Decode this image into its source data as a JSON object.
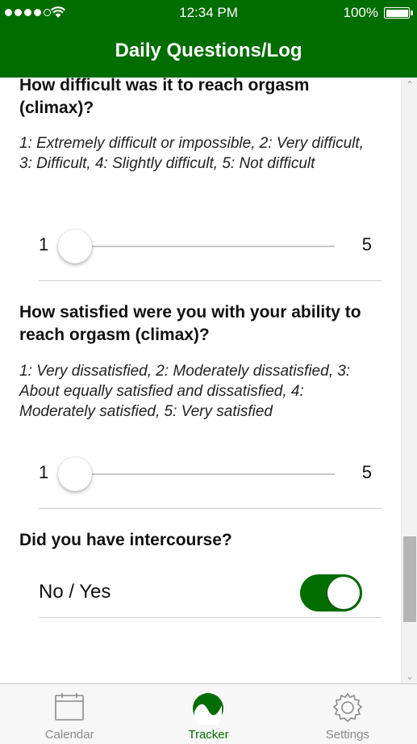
{
  "status_bar": {
    "time": "12:34 PM",
    "battery_percent": "100%",
    "signal_bars_filled": 4,
    "signal_bars_total": 5
  },
  "nav": {
    "title": "Daily Questions/Log"
  },
  "questions": [
    {
      "question": "How difficult was it to reach orgasm (climax)?",
      "hint": "1: Extremely difficult or impossible, 2: Very difficult, 3: Difficult, 4: Slightly difficult, 5: Not difficult",
      "slider": {
        "min_label": "1",
        "max_label": "5",
        "value": 1
      }
    },
    {
      "question": "How satisfied were you with your ability to reach orgasm (climax)?",
      "hint": "1: Very dissatisfied, 2: Moderately dissatisfied, 3: About equally satisfied and dissatisfied, 4: Moderately satisfied, 5: Very satisfied",
      "slider": {
        "min_label": "1",
        "max_label": "5",
        "value": 1
      }
    },
    {
      "question": "Did you have intercourse?",
      "toggle": {
        "label": "No / Yes",
        "value": true
      }
    }
  ],
  "tabs": [
    {
      "label": "Calendar",
      "icon": "calendar-icon",
      "active": false
    },
    {
      "label": "Tracker",
      "icon": "tracker-icon",
      "active": true
    },
    {
      "label": "Settings",
      "icon": "gear-icon",
      "active": false
    }
  ],
  "colors": {
    "brand_green": "#006d00",
    "inactive_tab": "#8a8a8a"
  }
}
